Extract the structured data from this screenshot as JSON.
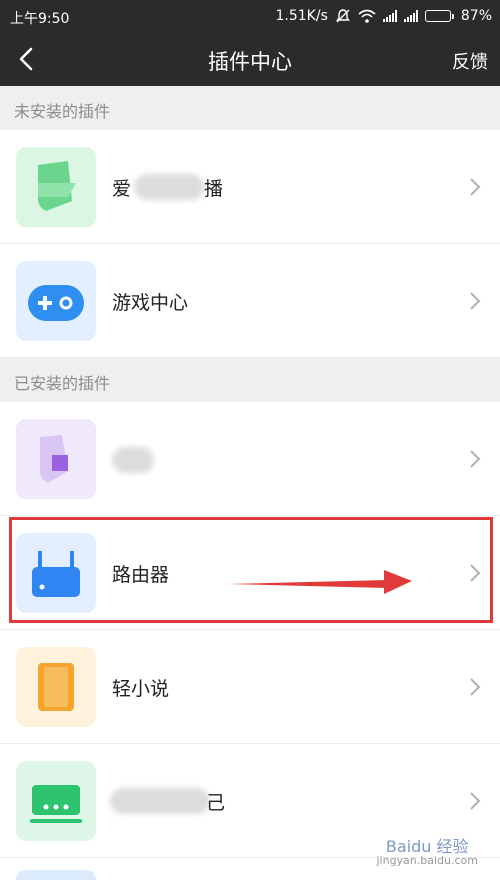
{
  "status_bar": {
    "time": "上午9:50",
    "net_speed": "1.51K/s",
    "battery": "87%",
    "battery_level": 0.87
  },
  "header": {
    "title": "插件中心",
    "feedback": "反馈"
  },
  "sections": {
    "uninstalled": "未安装的插件",
    "installed": "已安装的插件"
  },
  "plugins": [
    {
      "label": "爱",
      "label_tail": "播",
      "icon": "green-book-icon",
      "color": "#6bd58e"
    },
    {
      "label": "游戏中心",
      "icon": "gamepad-icon",
      "color": "#2e8ff0"
    },
    {
      "label": "",
      "icon": "purple-book-icon",
      "color": "#b487e6"
    },
    {
      "label": "路由器",
      "icon": "router-icon",
      "color": "#2f86f2"
    },
    {
      "label": "轻小说",
      "icon": "novel-book-icon",
      "color": "#f5a52f"
    },
    {
      "label": "",
      "label_tail": "己",
      "icon": "green-screen-icon",
      "color": "#2ec46f"
    }
  ],
  "watermark": {
    "brand": "Baidu 经验",
    "url": "jingyan.baidu.com"
  }
}
